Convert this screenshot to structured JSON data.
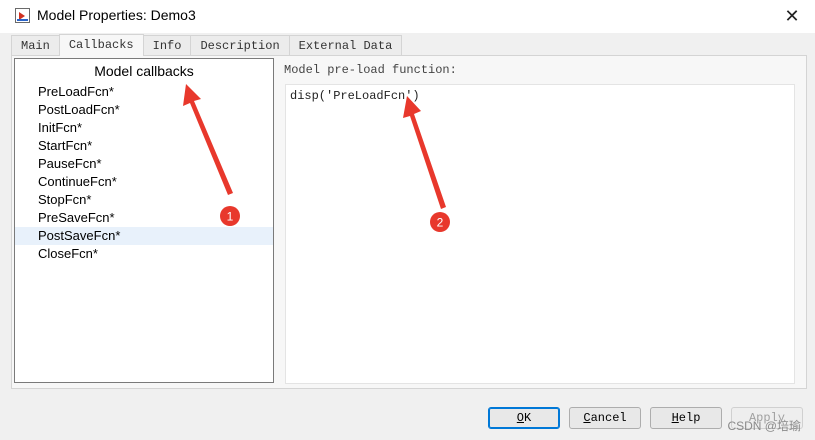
{
  "window": {
    "title": "Model Properties: Demo3",
    "close_glyph": "✕"
  },
  "tabs": [
    {
      "label": "Main"
    },
    {
      "label": "Callbacks",
      "active": true
    },
    {
      "label": "Info"
    },
    {
      "label": "Description"
    },
    {
      "label": "External Data"
    }
  ],
  "callbacks": {
    "header": "Model callbacks",
    "items": [
      {
        "label": "PreLoadFcn*"
      },
      {
        "label": "PostLoadFcn*"
      },
      {
        "label": "InitFcn*"
      },
      {
        "label": "StartFcn*"
      },
      {
        "label": "PauseFcn*"
      },
      {
        "label": "ContinueFcn*"
      },
      {
        "label": "StopFcn*"
      },
      {
        "label": "PreSaveFcn*"
      },
      {
        "label": "PostSaveFcn*",
        "selected": true
      },
      {
        "label": "CloseFcn*"
      }
    ]
  },
  "editor": {
    "label": "Model pre-load function:",
    "code": "disp('PreLoadFcn')"
  },
  "buttons": {
    "ok": {
      "mnemonic": "O",
      "rest": "K"
    },
    "cancel": {
      "mnemonic": "C",
      "rest": "ancel"
    },
    "help": {
      "mnemonic": "H",
      "rest": "elp"
    },
    "apply": "Apply"
  },
  "annotations": [
    {
      "number": "1"
    },
    {
      "number": "2"
    }
  ],
  "watermark": "CSDN @培瑜",
  "colors": {
    "annotation_red": "#e8382c",
    "selection": "#e8f1fb",
    "default_button_border": "#0078d7"
  }
}
